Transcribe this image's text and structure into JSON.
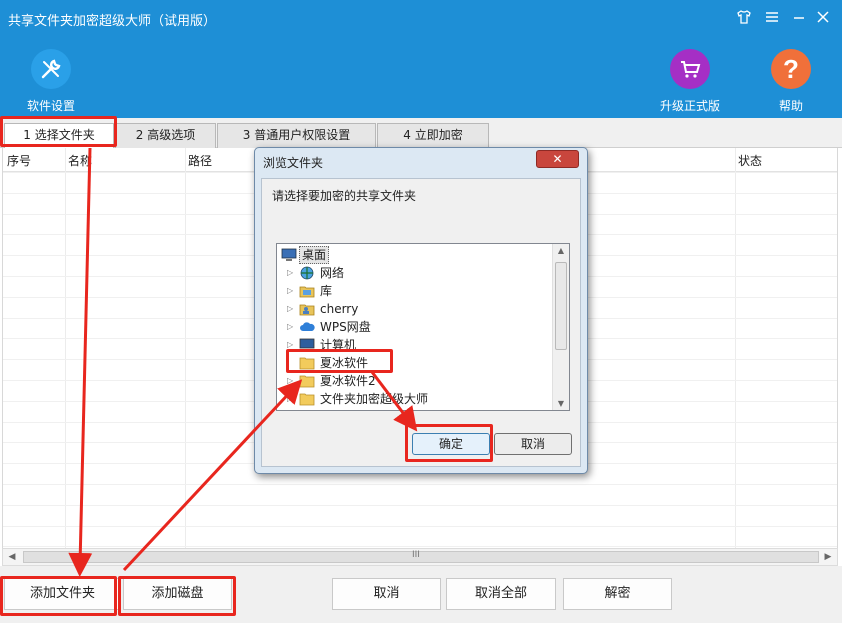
{
  "app": {
    "title": "共享文件夹加密超级大师（试用版）"
  },
  "toolbar": {
    "settings_label": "软件设置",
    "upgrade_label": "升级正式版",
    "help_label": "帮助"
  },
  "tabs": [
    {
      "label": "1 选择文件夹",
      "active": true
    },
    {
      "label": "2 高级选项"
    },
    {
      "label": "3 普通用户权限设置"
    },
    {
      "label": "4 立即加密"
    }
  ],
  "table": {
    "columns": [
      "序号",
      "名称",
      "路径",
      "状态"
    ],
    "rows": []
  },
  "scrollbar_grip": "III",
  "dialog": {
    "title": "浏览文件夹",
    "prompt": "请选择要加密的共享文件夹",
    "tree": [
      {
        "label": "桌面",
        "icon": "desktop-icon",
        "selected": true
      },
      {
        "label": "网络",
        "icon": "network-icon"
      },
      {
        "label": "库",
        "icon": "library-icon"
      },
      {
        "label": "cherry",
        "icon": "user-folder-icon"
      },
      {
        "label": "WPS网盘",
        "icon": "cloud-icon"
      },
      {
        "label": "计算机",
        "icon": "computer-icon"
      },
      {
        "label": "夏冰软件",
        "icon": "folder-icon"
      },
      {
        "label": "夏冰软件2",
        "icon": "folder-icon"
      },
      {
        "label": "文件夹加密超级大师",
        "icon": "folder-icon"
      }
    ],
    "ok_label": "确定",
    "cancel_label": "取消"
  },
  "bottom": {
    "add_folder_label": "添加文件夹",
    "add_disk_label": "添加磁盘",
    "cancel_label": "取消",
    "cancel_all_label": "取消全部",
    "decrypt_label": "解密"
  },
  "colors": {
    "header_blue": "#1e8fd6",
    "annotation_red": "#e8261e",
    "settings_icon_bg": "#2aa0e8",
    "upgrade_icon_bg": "#a52fc5",
    "help_icon_bg": "#f0703a"
  }
}
